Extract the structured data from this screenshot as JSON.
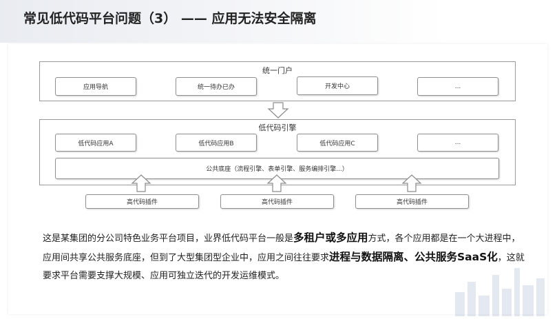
{
  "header": {
    "title": "常见低代码平台问题（3） —— 应用无法安全隔离"
  },
  "diagram": {
    "portal": {
      "title": "统一门户",
      "items": [
        "应用导航",
        "统一待办已办",
        "开发中心",
        "..."
      ]
    },
    "engine": {
      "title": "低代码引擎",
      "apps": [
        "低代码应用A",
        "低代码应用B",
        "低代码应用C",
        "..."
      ],
      "base": "公共底座（流程引擎、表单引擎、服务编排引擎...）"
    },
    "plugins": [
      "高代码插件",
      "高代码插件",
      "高代码插件"
    ]
  },
  "description": {
    "part1": "这是某集团的分公司特色业务平台项目，业界低代码平台一般是",
    "bold1": "多租户或多应用",
    "part2": "方式，各个应用都是在一个大进程中，应用间共享公共服务底座，但到了大型集团型企业中，应用之间往往要求",
    "bold2": "进程与数据隔离、公共服务SaaS化",
    "part3": "，这就要求平台需要支撑大规模、应用可独立迭代的开发运维模式。"
  },
  "colors": {
    "frame_border": "#9a9a9a",
    "arrow_stroke": "#8a8a8a"
  }
}
